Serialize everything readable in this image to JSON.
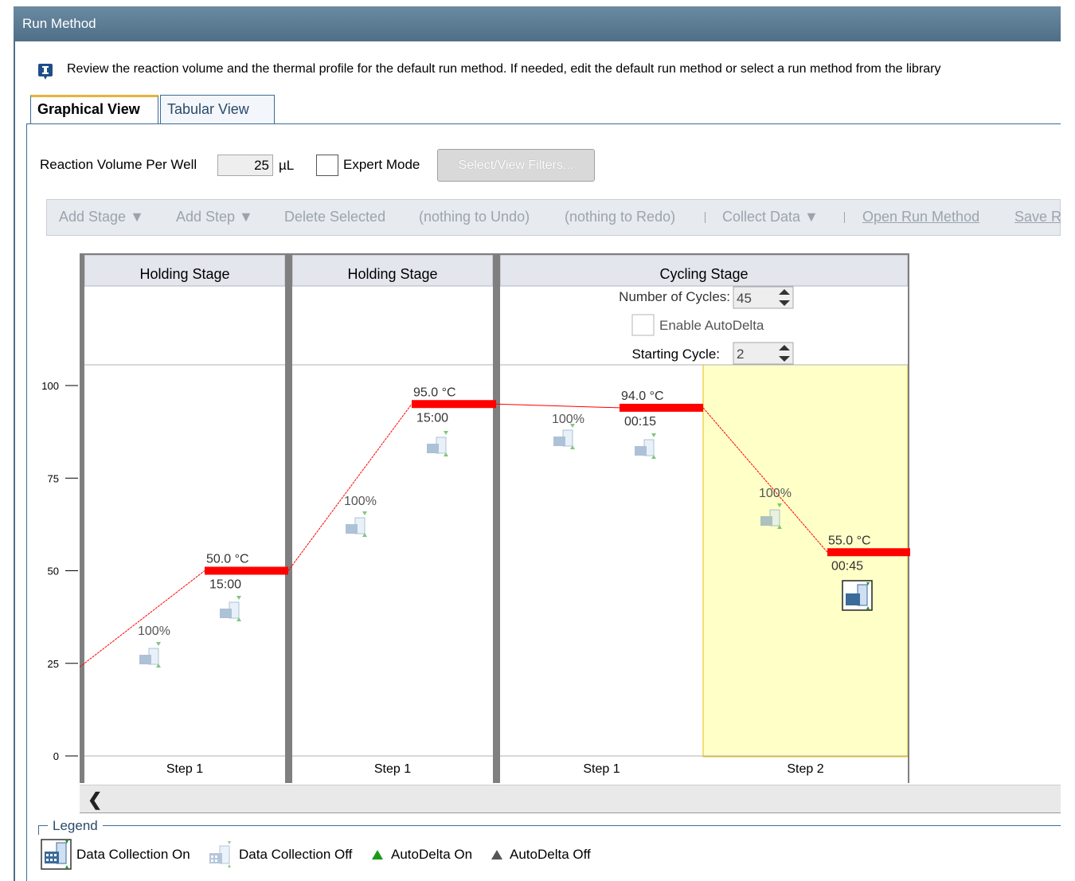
{
  "window": {
    "title": "Run Method"
  },
  "info": {
    "text": "Review the reaction volume and the thermal profile for the default run method. If needed, edit the default run method or select a run method from the library"
  },
  "tabs": [
    {
      "label": "Graphical View",
      "active": true
    },
    {
      "label": "Tabular View",
      "active": false
    }
  ],
  "settings": {
    "reaction_volume_label": "Reaction Volume Per Well",
    "reaction_volume_value": "25",
    "reaction_volume_unit": "µL",
    "expert_mode_label": "Expert Mode",
    "expert_mode_checked": false,
    "filters_button": "Select/View Filters..."
  },
  "toolbar": {
    "add_stage": "Add Stage ▼",
    "add_step": "Add Step ▼",
    "delete_selected": "Delete Selected",
    "undo": "(nothing to Undo)",
    "redo": "(nothing to Redo)",
    "collect_data": "Collect Data ▼",
    "open_run_method": "Open Run Method",
    "save": "Save R"
  },
  "colors": {
    "ramp_line": "#ff0000",
    "hold_bar": "#ff0000",
    "selected_step_bg": "#ffffc8",
    "stage_header_bg": "#e4e6ee",
    "stage_divider": "#7f7f7f",
    "accent_blue": "#3b6b98"
  },
  "y_axis": {
    "ticks": [
      "100",
      "75",
      "50",
      "25",
      "0"
    ]
  },
  "stages": [
    {
      "title": "Holding Stage",
      "steps": [
        "Step 1"
      ]
    },
    {
      "title": "Holding Stage",
      "steps": [
        "Step 1"
      ]
    },
    {
      "title": "Cycling Stage",
      "steps": [
        "Step 1",
        "Step 2"
      ],
      "cycles_label": "Number of Cycles:",
      "cycles_value": "45",
      "autodelta_label": "Enable AutoDelta",
      "autodelta_checked": false,
      "starting_cycle_label": "Starting Cycle:",
      "starting_cycle_value": "2"
    }
  ],
  "chart_data": {
    "type": "line",
    "ylim": [
      0,
      100
    ],
    "profile": [
      {
        "stage": "Holding Stage",
        "step": "Step 1",
        "temperature_c": 50.0,
        "temperature_label": "50.0 °C",
        "time": "15:00",
        "ramp_label": "100%",
        "data_collection": false,
        "selected": false
      },
      {
        "stage": "Holding Stage",
        "step": "Step 1",
        "temperature_c": 95.0,
        "temperature_label": "95.0 °C",
        "time": "15:00",
        "ramp_label": "100%",
        "data_collection": false,
        "selected": false
      },
      {
        "stage": "Cycling Stage",
        "step": "Step 1",
        "temperature_c": 94.0,
        "temperature_label": "94.0 °C",
        "time": "00:15",
        "ramp_label": "100%",
        "data_collection": false,
        "selected": false
      },
      {
        "stage": "Cycling Stage",
        "step": "Step 2",
        "temperature_c": 55.0,
        "temperature_label": "55.0 °C",
        "time": "00:45",
        "ramp_label": "100%",
        "data_collection": true,
        "selected": true
      }
    ],
    "start_temperature_c": 24
  },
  "legend": {
    "title": "Legend",
    "items": [
      {
        "icon": "data-collection-on-icon",
        "label": "Data Collection On"
      },
      {
        "icon": "data-collection-off-icon",
        "label": "Data Collection Off"
      },
      {
        "icon": "autodelta-on-icon",
        "label": "AutoDelta On",
        "color": "#1a9a1a"
      },
      {
        "icon": "autodelta-off-icon",
        "label": "AutoDelta Off",
        "color": "#555555"
      }
    ]
  }
}
